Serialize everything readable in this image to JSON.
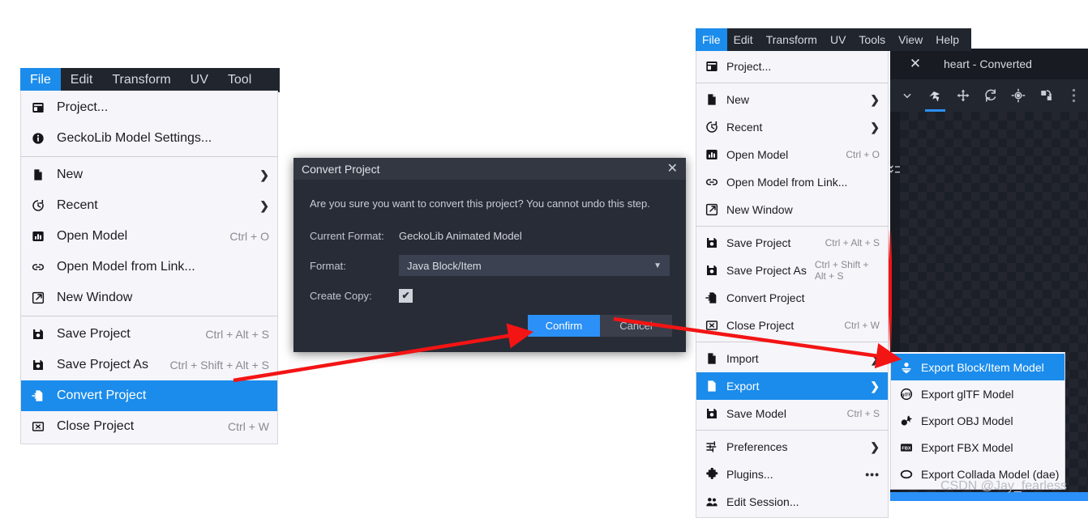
{
  "menubar": {
    "items": [
      "File",
      "Edit",
      "Transform",
      "UV",
      "Tools",
      "View",
      "Help"
    ],
    "active": "File"
  },
  "left_menubar": {
    "items": [
      "File",
      "Edit",
      "Transform",
      "UV",
      "Tool"
    ],
    "active": "File"
  },
  "file_menu": {
    "items": [
      {
        "icon": "project-icon",
        "label": "Project...",
        "accel": "",
        "arrow": false
      },
      {
        "icon": "info-icon",
        "label": "GeckoLib Model Settings...",
        "accel": "",
        "arrow": false
      },
      {
        "icon": "new-file-icon",
        "label": "New",
        "accel": "",
        "arrow": true
      },
      {
        "icon": "recent-clock-icon",
        "label": "Recent",
        "accel": "",
        "arrow": true
      },
      {
        "icon": "open-model-icon",
        "label": "Open Model",
        "accel": "Ctrl + O",
        "arrow": false
      },
      {
        "icon": "link-icon",
        "label": "Open Model from Link...",
        "accel": "",
        "arrow": false
      },
      {
        "icon": "new-window-icon",
        "label": "New Window",
        "accel": "",
        "arrow": false
      },
      {
        "icon": "save-icon",
        "label": "Save Project",
        "accel": "Ctrl + Alt + S",
        "arrow": false
      },
      {
        "icon": "save-icon",
        "label": "Save Project As",
        "accel": "Ctrl + Shift + Alt + S",
        "arrow": false
      },
      {
        "icon": "convert-icon",
        "label": "Convert Project",
        "accel": "",
        "arrow": false
      },
      {
        "icon": "close-box-icon",
        "label": "Close Project",
        "accel": "Ctrl + W",
        "arrow": false
      }
    ],
    "selected_label": "Convert Project"
  },
  "right_file_menu": {
    "items": [
      {
        "icon": "project-icon",
        "label": "Project...",
        "accel": "",
        "arrow": false,
        "dots": false
      },
      {
        "icon": "new-file-icon",
        "label": "New",
        "accel": "",
        "arrow": true,
        "dots": false
      },
      {
        "icon": "recent-clock-icon",
        "label": "Recent",
        "accel": "",
        "arrow": true,
        "dots": false
      },
      {
        "icon": "open-model-icon",
        "label": "Open Model",
        "accel": "Ctrl + O",
        "arrow": false,
        "dots": false
      },
      {
        "icon": "link-icon",
        "label": "Open Model from Link...",
        "accel": "",
        "arrow": false,
        "dots": false
      },
      {
        "icon": "new-window-icon",
        "label": "New Window",
        "accel": "",
        "arrow": false,
        "dots": false
      },
      {
        "icon": "save-icon",
        "label": "Save Project",
        "accel": "Ctrl + Alt + S",
        "arrow": false,
        "dots": false
      },
      {
        "icon": "save-icon",
        "label": "Save Project As",
        "accel": "Ctrl + Shift + Alt + S",
        "arrow": false,
        "dots": false
      },
      {
        "icon": "convert-icon",
        "label": "Convert Project",
        "accel": "",
        "arrow": false,
        "dots": false
      },
      {
        "icon": "close-box-icon",
        "label": "Close Project",
        "accel": "Ctrl + W",
        "arrow": false,
        "dots": false
      },
      {
        "icon": "import-icon",
        "label": "Import",
        "accel": "",
        "arrow": true,
        "dots": false
      },
      {
        "icon": "export-icon",
        "label": "Export",
        "accel": "",
        "arrow": true,
        "dots": false
      },
      {
        "icon": "save-icon",
        "label": "Save Model",
        "accel": "Ctrl + S",
        "arrow": false,
        "dots": false
      },
      {
        "icon": "preferences-icon",
        "label": "Preferences",
        "accel": "",
        "arrow": true,
        "dots": false
      },
      {
        "icon": "plugins-icon",
        "label": "Plugins...",
        "accel": "",
        "arrow": false,
        "dots": true
      },
      {
        "icon": "session-icon",
        "label": "Edit Session...",
        "accel": "",
        "arrow": false,
        "dots": false
      }
    ],
    "selected_label": "Export"
  },
  "export_submenu": {
    "items": [
      {
        "icon": "export-block-item-icon",
        "label": "Export Block/Item Model"
      },
      {
        "icon": "gltf-icon",
        "label": "Export glTF Model"
      },
      {
        "icon": "obj-icon",
        "label": "Export OBJ Model"
      },
      {
        "icon": "fbx-icon",
        "label": "Export FBX Model"
      },
      {
        "icon": "collada-icon",
        "label": "Export Collada Model (dae)"
      }
    ],
    "selected_label": "Export Block/Item Model"
  },
  "dialog": {
    "title": "Convert Project",
    "close_label": "✕",
    "message": "Are you sure you want to convert this project? You cannot undo this step.",
    "current_format_label": "Current Format:",
    "current_format_value": "GeckoLib Animated Model",
    "format_label": "Format:",
    "format_value": "Java Block/Item",
    "format_caret": "▼",
    "create_copy_label": "Create Copy:",
    "create_copy_checked": true,
    "check_glyph": "✔",
    "confirm_label": "Confirm",
    "cancel_label": "Cancel"
  },
  "app_window": {
    "title": "heart - Converted",
    "close_label": "✕",
    "toolbar_icons": [
      "chevron-down-icon",
      "pivot-tool-icon",
      "move-tool-icon",
      "rotate-tool-icon",
      "scale-tool-icon",
      "pivot-point-icon",
      "more-options-icon"
    ],
    "active_tool": "pivot-tool-icon"
  },
  "watermark": {
    "text": "CSDN @Jay_fearless"
  },
  "colors": {
    "accent_blue": "#1b8ceb",
    "button_blue": "#2b90f7",
    "menu_bg": "#f6f5fa",
    "menubar_bg": "#21252e",
    "dialog_bg": "#282c37",
    "arrow_red": "#f31414"
  }
}
